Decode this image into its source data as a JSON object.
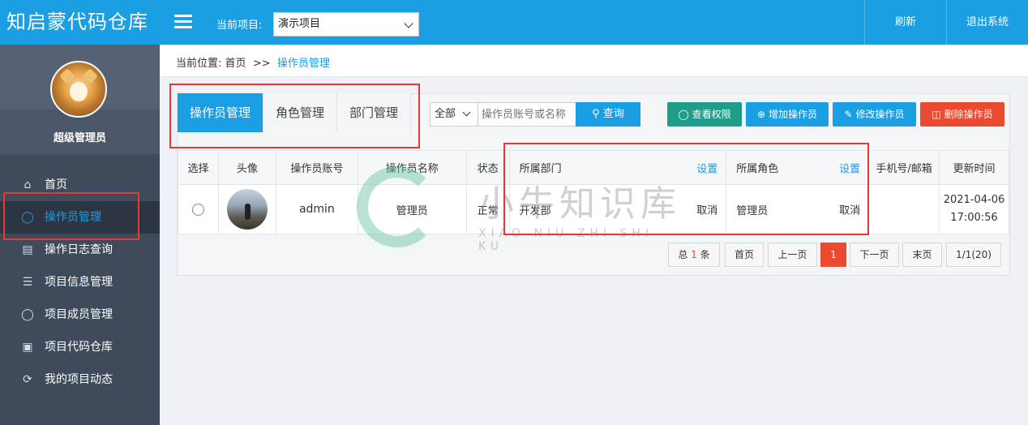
{
  "app": {
    "logo": "知启蒙代码仓库"
  },
  "header": {
    "project_label": "当前项目:",
    "project_value": "演示项目",
    "refresh": "刷新",
    "logout": "退出系统"
  },
  "profile": {
    "name": "超级管理员"
  },
  "sidebar": {
    "items": [
      {
        "label": "首页",
        "icon": "home-icon"
      },
      {
        "label": "操作员管理",
        "icon": "user-icon"
      },
      {
        "label": "操作日志查询",
        "icon": "document-icon"
      },
      {
        "label": "项目信息管理",
        "icon": "list-icon"
      },
      {
        "label": "项目成员管理",
        "icon": "user-icon"
      },
      {
        "label": "项目代码仓库",
        "icon": "briefcase-icon"
      },
      {
        "label": "我的项目动态",
        "icon": "refresh-icon"
      }
    ]
  },
  "breadcrumb": {
    "prefix": "当前位置:",
    "home": "首页",
    "sep": ">>",
    "current": "操作员管理"
  },
  "tabs": [
    {
      "label": "操作员管理"
    },
    {
      "label": "角色管理"
    },
    {
      "label": "部门管理"
    }
  ],
  "search": {
    "filter_value": "全部",
    "placeholder": "操作员账号或名称",
    "button": "查询"
  },
  "actions": {
    "view_perm": "查看权限",
    "add": "增加操作员",
    "edit": "修改操作员",
    "delete": "删除操作员",
    "colors": {
      "view": "#1e9e8a",
      "add": "#1a9ee4",
      "edit": "#1a9ee4",
      "delete": "#ea4a2f"
    }
  },
  "table": {
    "headers": [
      "选择",
      "头像",
      "操作员账号",
      "操作员名称",
      "状态",
      "所属部门",
      "设置",
      "所属角色",
      "设置",
      "手机号/邮箱",
      "更新时间"
    ],
    "rows": [
      {
        "account": "admin",
        "name": "管理员",
        "status": "正常",
        "dept": "开发部",
        "dept_action": "取消",
        "role": "管理员",
        "role_action": "取消",
        "contact": "",
        "updated_date": "2021-04-06",
        "updated_time": "17:00:56"
      }
    ]
  },
  "pagination": {
    "total_prefix": "总",
    "total_count": "1",
    "total_suffix": "条",
    "first": "首页",
    "prev": "上一页",
    "current": "1",
    "next": "下一页",
    "last": "末页",
    "info": "1/1(20)"
  },
  "watermark": {
    "text": "小牛知识库",
    "sub": "XIAO NIU ZHI SHI KU"
  }
}
